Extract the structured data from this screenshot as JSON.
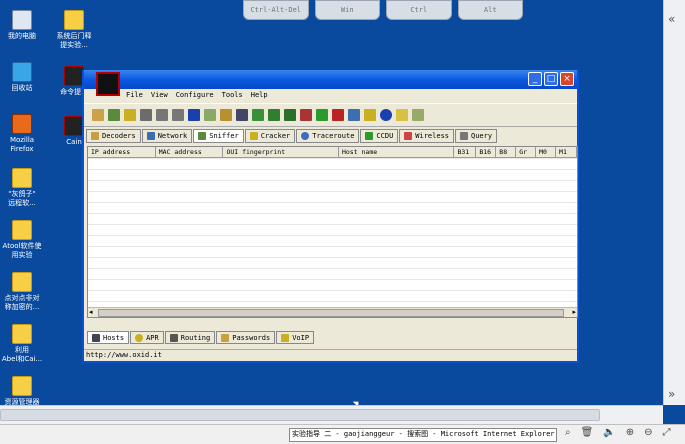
{
  "rdp_toolbar": [
    "Ctrl-Alt-Del",
    "Win",
    "Ctrl",
    "Alt"
  ],
  "desktop_icons": [
    {
      "label": "我的电脑",
      "kind": "pc"
    },
    {
      "label": "系统后门释\n提实验...",
      "kind": "folder"
    },
    {
      "label": "回收站",
      "kind": "bin"
    },
    {
      "label": "命令提...",
      "kind": "cain"
    },
    {
      "label": "Mozilla\nFirefox",
      "kind": "ff"
    },
    {
      "label": "Cain",
      "kind": "cain"
    },
    {
      "label": "\"灰鸽子\"\n远程软...",
      "kind": "folder"
    },
    {
      "label": "Atool软件使\n用实验",
      "kind": "folder"
    },
    {
      "label": "点对点非对\n称加密的...",
      "kind": "folder"
    },
    {
      "label": "利用\nAbel和Cai...",
      "kind": "folder"
    },
    {
      "label": "资源管理器",
      "kind": "folder"
    }
  ],
  "window": {
    "menu": [
      "File",
      "View",
      "Configure",
      "Tools",
      "Help"
    ],
    "tabs": [
      "Decoders",
      "Network",
      "Sniffer",
      "Cracker",
      "Traceroute",
      "CCDU",
      "Wireless",
      "Query"
    ],
    "active_tab": "Sniffer",
    "columns": [
      "IP address",
      "MAC address",
      "OUI fingerprint",
      "Host name",
      "B31",
      "B16",
      "B8",
      "Gr",
      "M0",
      "M1"
    ],
    "bottom_tabs": [
      "Hosts",
      "APR",
      "Routing",
      "Passwords",
      "VoIP"
    ],
    "active_bottom_tab": "Hosts",
    "status": "http://www.oxid.it"
  },
  "taskbar": {
    "title": "实验指导 二 - gaojianggeur - 搜索图 - Microsoft Internet Explorer"
  }
}
